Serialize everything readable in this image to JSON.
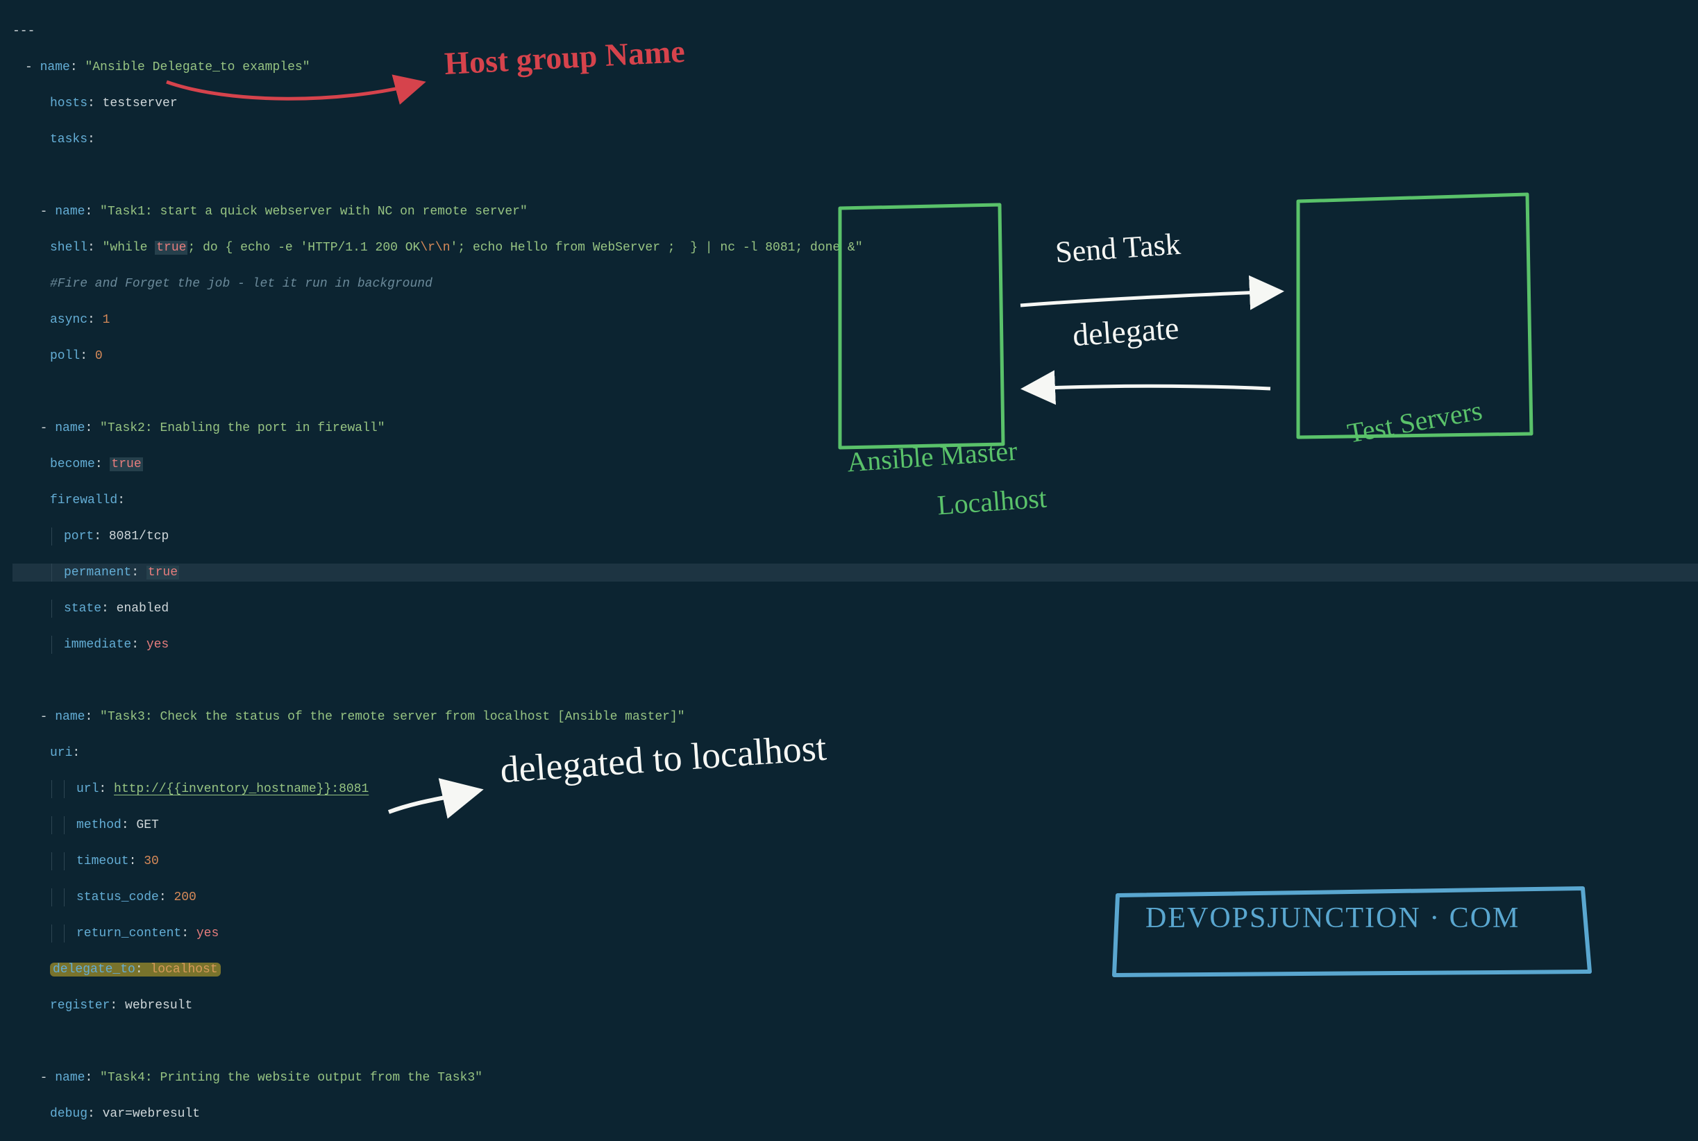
{
  "header_dashes": "---",
  "play": {
    "name_key": "name",
    "name_val": "\"Ansible Delegate_to examples\"",
    "hosts_key": "hosts",
    "hosts_val": "testserver",
    "tasks_key": "tasks"
  },
  "task1": {
    "name_key": "name",
    "name_val": "\"Task1: start a quick webserver with NC on remote server\"",
    "shell_key": "shell",
    "shell_pre": "\"while ",
    "shell_true": "true",
    "shell_mid1": "; do { echo -e 'HTTP/1.1 200 OK",
    "shell_esc": "\\r\\n",
    "shell_mid2": "'; echo Hello from WebServer ;  } | nc -l 8081; done &\"",
    "comment": "#Fire and Forget the job - let it run in background",
    "async_key": "async",
    "async_val": "1",
    "poll_key": "poll",
    "poll_val": "0"
  },
  "task2": {
    "name_key": "name",
    "name_val": "\"Task2: Enabling the port in firewall\"",
    "become_key": "become",
    "become_val": "true",
    "firewalld_key": "firewalld",
    "port_key": "port",
    "port_val": "8081/tcp",
    "permanent_key": "permanent",
    "permanent_val": "true",
    "state_key": "state",
    "state_val": "enabled",
    "immediate_key": "immediate",
    "immediate_val": "yes"
  },
  "task3": {
    "name_key": "name",
    "name_val": "\"Task3: Check the status of the remote server from localhost [Ansible master]\"",
    "uri_key": "uri",
    "url_key": "url",
    "url_val": "http://{{inventory_hostname}}:8081",
    "method_key": "method",
    "method_val": "GET",
    "timeout_key": "timeout",
    "timeout_val": "30",
    "status_key": "status_code",
    "status_val": "200",
    "return_key": "return_content",
    "return_val": "yes",
    "delegate_key": "delegate_to",
    "delegate_val": "localhost",
    "register_key": "register",
    "register_val": "webresult"
  },
  "task4": {
    "name_key": "name",
    "name_val": "\"Task4: Printing the website output from the Task3\"",
    "debug_key": "debug",
    "debug_val": "var=webresult"
  },
  "annotations": {
    "hostgroup": "Host group Name",
    "send_task": "Send Task",
    "delegate": "delegate",
    "ansible_master_l1": "Ansible Master",
    "ansible_master_l2": "Localhost",
    "test_servers": "Test Servers",
    "delegated_localhost": "delegated  to  localhost",
    "site": "DEVOPSJUNCTION · COM"
  }
}
